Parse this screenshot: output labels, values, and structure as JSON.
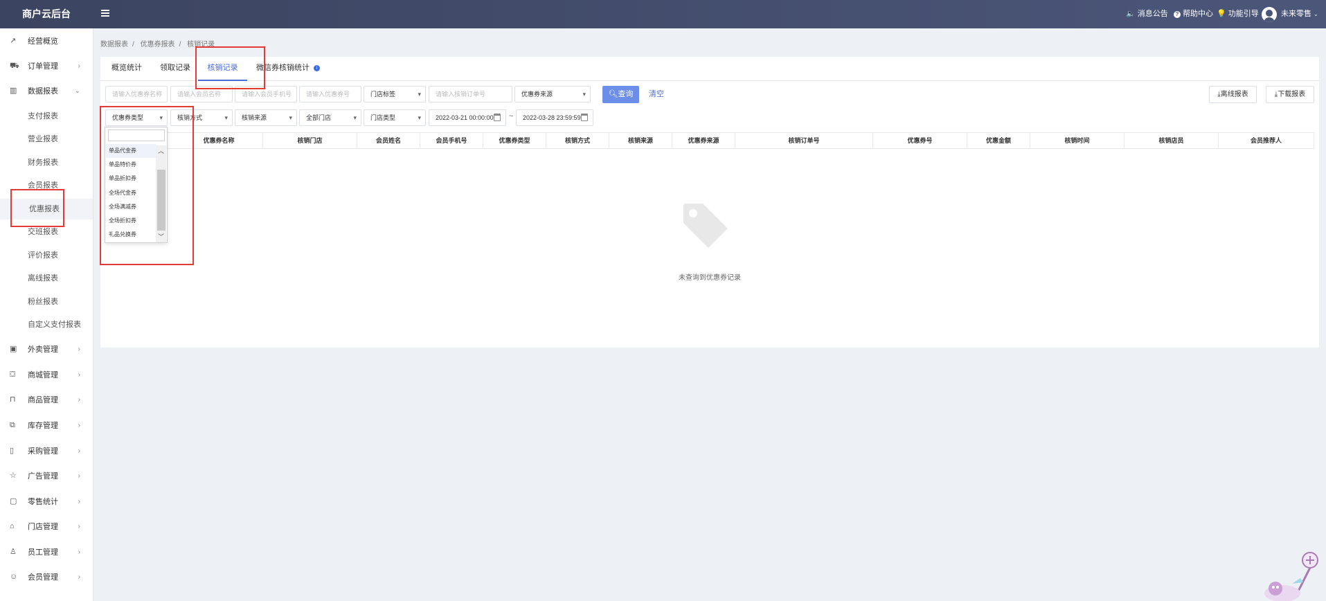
{
  "header": {
    "logo": "商户云后台",
    "notice": "消息公告",
    "help": "帮助中心",
    "guide": "功能引导",
    "user": "未来零售"
  },
  "sidebar": {
    "items": [
      {
        "label": "经营概览",
        "icon": "trend-icon"
      },
      {
        "label": "订单管理",
        "icon": "cart-icon"
      },
      {
        "label": "数据报表",
        "icon": "bar-chart-icon"
      },
      {
        "label": "外卖管理",
        "icon": "calendar-icon"
      },
      {
        "label": "商城管理",
        "icon": "shop-icon"
      },
      {
        "label": "商品管理",
        "icon": "bag-icon"
      },
      {
        "label": "库存管理",
        "icon": "box-icon"
      },
      {
        "label": "采购管理",
        "icon": "phone-icon"
      },
      {
        "label": "广告管理",
        "icon": "star-icon"
      },
      {
        "label": "零售统计",
        "icon": "clipboard-icon"
      },
      {
        "label": "门店管理",
        "icon": "home-icon"
      },
      {
        "label": "员工管理",
        "icon": "user-icon"
      },
      {
        "label": "会员管理",
        "icon": "smile-icon"
      }
    ],
    "subitems": [
      "支付报表",
      "营业报表",
      "财务报表",
      "会员报表",
      "优惠报表",
      "交班报表",
      "评价报表",
      "离线报表",
      "粉丝报表",
      "自定义支付报表"
    ]
  },
  "breadcrumb": [
    "数据报表",
    "优惠券报表",
    "核销记录"
  ],
  "tabs": [
    "概览统计",
    "领取记录",
    "核销记录",
    "微信券核销统计"
  ],
  "filters": {
    "coupon_name": "请输入优惠券名称",
    "member_name": "请输入会员名称",
    "member_phone": "请输入会员手机号",
    "coupon_no": "请输入优惠券号",
    "store_tag": "门店标签",
    "order_no": "请输入核销订单号",
    "coupon_source": "优惠券来源",
    "coupon_type": "优惠券类型",
    "verify_method": "核销方式",
    "verify_source": "核销来源",
    "all_stores": "全部门店",
    "store_type": "门店类型",
    "start_time": "2022-03-21 00:00:00",
    "range_sep": "~",
    "end_time": "2022-03-28 23:59:59"
  },
  "buttons": {
    "query": "查询",
    "clear": "清空",
    "offline_report": "离线报表",
    "download_report": "下载报表"
  },
  "table": {
    "headers": [
      "优惠券名称",
      "核销门店",
      "会员姓名",
      "会员手机号",
      "优惠券类型",
      "核销方式",
      "核销来源",
      "优惠券来源",
      "核销订单号",
      "优惠券号",
      "优惠金额",
      "核销时间",
      "核销店员",
      "会员推荐人"
    ]
  },
  "empty_text": "未查询到优惠券记录",
  "dropdown": {
    "options": [
      "单品代金券",
      "单品特价券",
      "单品折扣券",
      "全场代金券",
      "全场满减券",
      "全场折扣券",
      "礼品兑换券"
    ]
  },
  "colors": {
    "accent": "#4a6cd8",
    "topbar": "#434c6b",
    "highlight_box": "#e53935",
    "button": "#6b8ee8"
  }
}
